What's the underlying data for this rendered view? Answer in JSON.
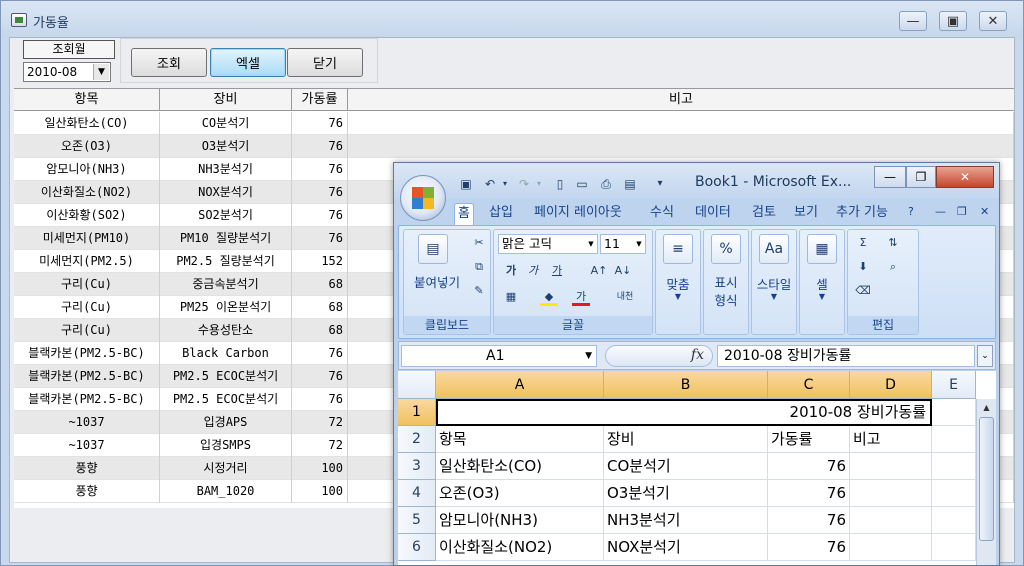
{
  "main_window": {
    "title": "가동율",
    "minimize_glyph": "—",
    "maximize_glyph": "▣",
    "close_glyph": "✕"
  },
  "query": {
    "label": "조회월",
    "month": "2010-08",
    "buttons": {
      "search": "조회",
      "excel": "엑셀",
      "close": "닫기"
    }
  },
  "grid": {
    "columns": [
      "항목",
      "장비",
      "가동률",
      "비고"
    ],
    "rows": [
      {
        "item": "일산화탄소(CO)",
        "equipment": "CO분석기",
        "rate": "76",
        "note": ""
      },
      {
        "item": "오존(O3)",
        "equipment": "O3분석기",
        "rate": "76",
        "note": ""
      },
      {
        "item": "암모니아(NH3)",
        "equipment": "NH3분석기",
        "rate": "76",
        "note": ""
      },
      {
        "item": "이산화질소(NO2)",
        "equipment": "NOX분석기",
        "rate": "76",
        "note": ""
      },
      {
        "item": "이산화황(SO2)",
        "equipment": "SO2분석기",
        "rate": "76",
        "note": ""
      },
      {
        "item": "미세먼지(PM10)",
        "equipment": "PM10 질량분석기",
        "rate": "76",
        "note": ""
      },
      {
        "item": "미세먼지(PM2.5)",
        "equipment": "PM2.5 질량분석기",
        "rate": "152",
        "note": ""
      },
      {
        "item": "구리(Cu)",
        "equipment": "중금속분석기",
        "rate": "68",
        "note": ""
      },
      {
        "item": "구리(Cu)",
        "equipment": "PM25 이온분석기",
        "rate": "68",
        "note": ""
      },
      {
        "item": "구리(Cu)",
        "equipment": "수용성탄소",
        "rate": "68",
        "note": ""
      },
      {
        "item": "블랙카본(PM2.5-BC)",
        "equipment": "Black Carbon",
        "rate": "76",
        "note": ""
      },
      {
        "item": "블랙카본(PM2.5-BC)",
        "equipment": "PM2.5 ECOC분석기",
        "rate": "76",
        "note": ""
      },
      {
        "item": "블랙카본(PM2.5-BC)",
        "equipment": "PM2.5 ECOC분석기",
        "rate": "76",
        "note": ""
      },
      {
        "item": "~1037",
        "equipment": "입경APS",
        "rate": "72",
        "note": ""
      },
      {
        "item": "~1037",
        "equipment": "입경SMPS",
        "rate": "72",
        "note": ""
      },
      {
        "item": "풍향",
        "equipment": "시정거리",
        "rate": "100",
        "note": ""
      },
      {
        "item": "풍향",
        "equipment": "BAM_1020",
        "rate": "100",
        "note": ""
      }
    ]
  },
  "excel": {
    "title": "Book1 - Microsoft Ex...",
    "tabs": [
      "홈",
      "삽입",
      "페이지 레이아웃",
      "수식",
      "데이터",
      "검토",
      "보기",
      "추가 기능"
    ],
    "ribbon": {
      "paste_label": "붙여넣기",
      "clipboard_group": "클립보드",
      "font_name": "맑은 고딕",
      "font_size": "11",
      "font_group": "글꼴",
      "align_label": "맞춤",
      "number_label_1": "표시",
      "number_label_2": "형식",
      "style_label": "스타일",
      "cell_label": "셀",
      "edit_group": "편집",
      "bold_glyph": "가",
      "italic_glyph": "가",
      "underline_glyph": "가",
      "font_color_glyph": "가",
      "phonetic_glyph": "내천"
    },
    "name_box": "A1",
    "formula": "2010-08 장비가동률",
    "columns": [
      "A",
      "B",
      "C",
      "D",
      "E"
    ],
    "row_numbers": [
      "1",
      "2",
      "3",
      "4",
      "5",
      "6"
    ],
    "a1_text": "2010-08 장비가동률",
    "sheet_rows": [
      {
        "a": "항목",
        "b": "장비",
        "c": "가동률",
        "d": "비고"
      },
      {
        "a": "일산화탄소(CO)",
        "b": "CO분석기",
        "c": "76",
        "d": ""
      },
      {
        "a": "오존(O3)",
        "b": "O3분석기",
        "c": "76",
        "d": ""
      },
      {
        "a": "암모니아(NH3)",
        "b": "NH3분석기",
        "c": "76",
        "d": ""
      },
      {
        "a": "이산화질소(NO2)",
        "b": "NOX분석기",
        "c": "76",
        "d": ""
      }
    ],
    "colors": {
      "selected_header": "#f1c15f",
      "ribbon_text": "#15428b"
    }
  }
}
